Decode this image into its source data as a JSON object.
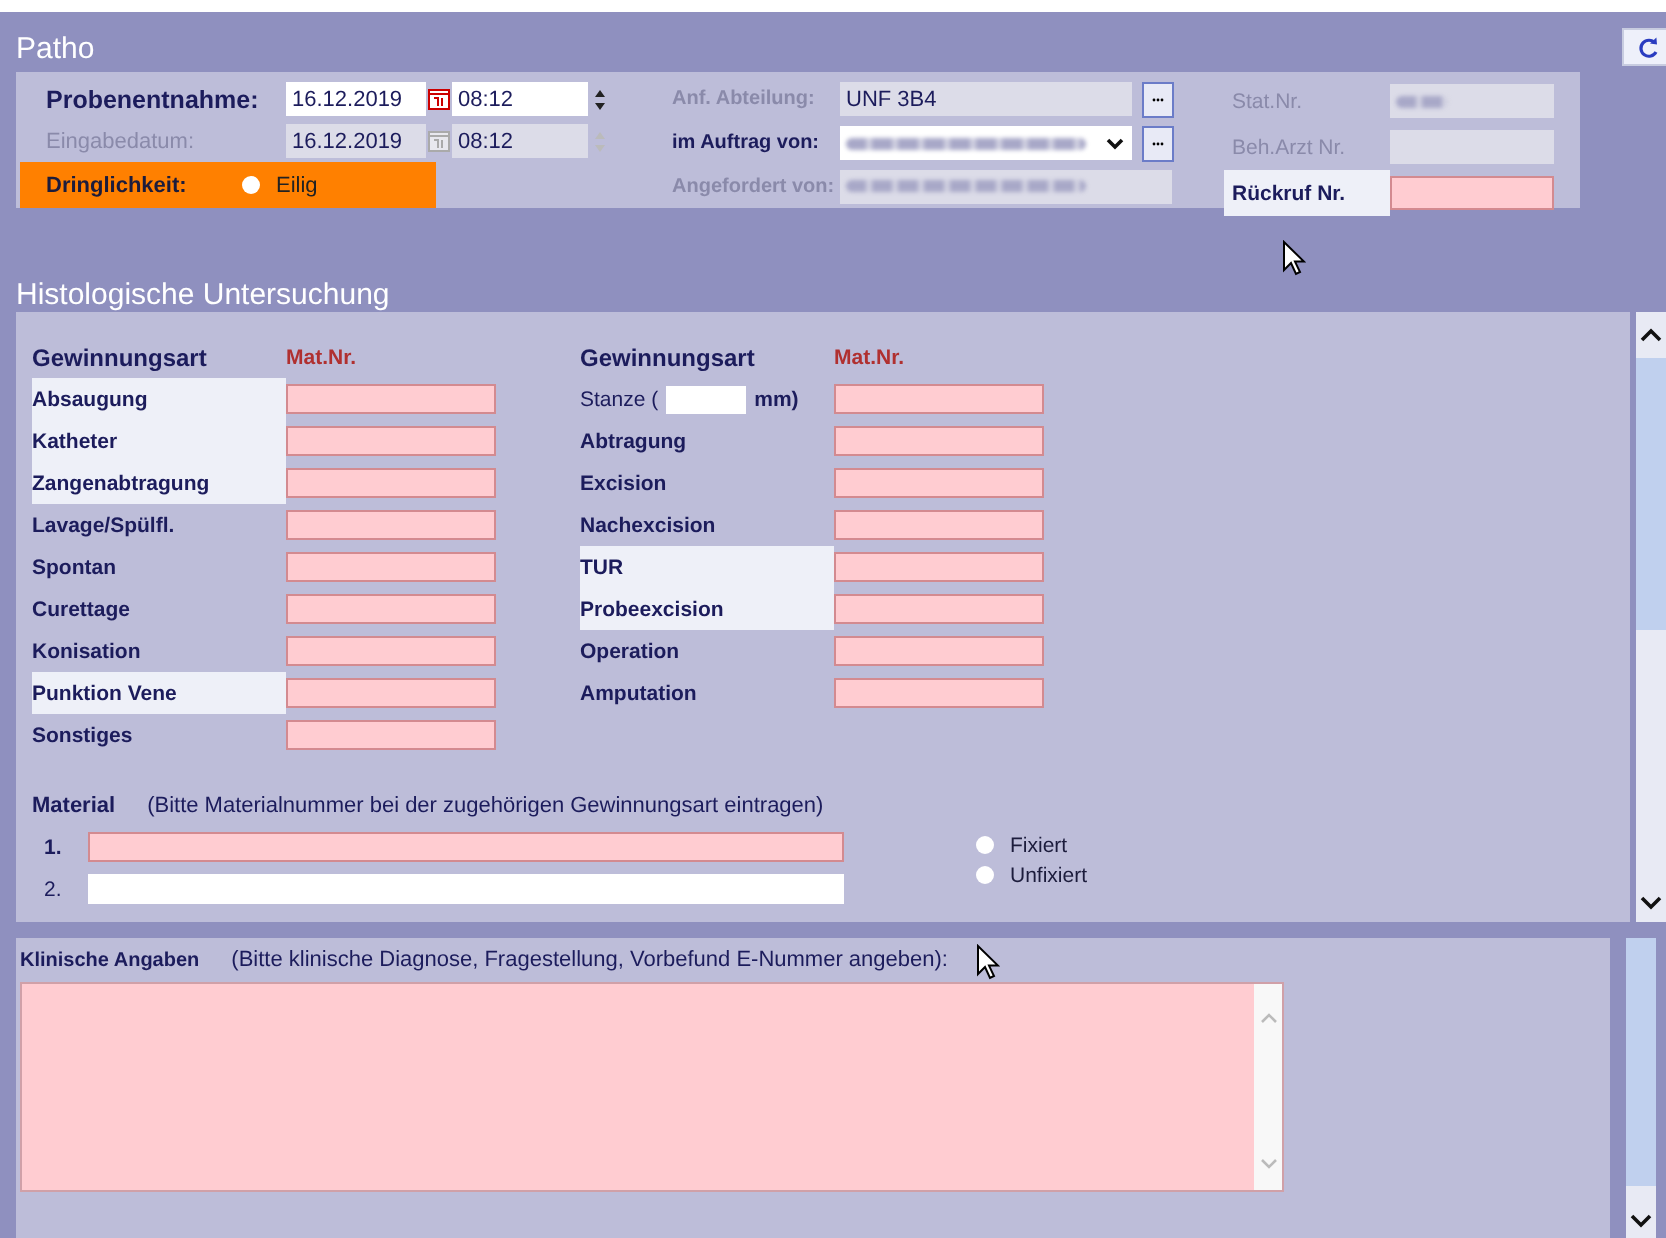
{
  "window": {
    "title": "Patho"
  },
  "header": {
    "date_rows": [
      {
        "label": "Probenentnahme:",
        "date": "16.12.2019",
        "time": "08:12",
        "disabled": false
      },
      {
        "label": "Eingabedatum:",
        "date": "16.12.2019",
        "time": "08:12",
        "disabled": true
      }
    ],
    "urgency": {
      "label": "Dringlichkeit:",
      "option": "Eilig",
      "selected": false
    },
    "middle_rows": [
      {
        "kind": "lookup",
        "label": "Anf. Abteilung:",
        "value": "UNF 3B4",
        "label_disabled": true,
        "redacted": false
      },
      {
        "kind": "dropdown",
        "label": "im Auftrag von:",
        "label_disabled": false,
        "redacted": true
      },
      {
        "kind": "readonly",
        "label": "Angefordert von:",
        "label_disabled": true,
        "redacted": true
      }
    ],
    "right_rows": [
      {
        "label": "Stat.Nr.",
        "disabled": true,
        "highlighted": false,
        "redacted": true
      },
      {
        "label": "Beh.Arzt Nr.",
        "disabled": true,
        "highlighted": false,
        "redacted": false
      },
      {
        "label": "Rückruf Nr.",
        "disabled": false,
        "highlighted": true,
        "redacted": false
      }
    ]
  },
  "histology": {
    "title": "Histologische Untersuchung",
    "columns": [
      {
        "heading": "Gewinnungsart",
        "mat_heading": "Mat.Nr.",
        "items": [
          {
            "kind": "plain",
            "label": "Absaugung",
            "highlighted": true
          },
          {
            "kind": "plain",
            "label": "Katheter",
            "highlighted": true
          },
          {
            "kind": "plain",
            "label": "Zangenabtragung",
            "highlighted": true
          },
          {
            "kind": "plain",
            "label": "Lavage/Spülfl.",
            "highlighted": false
          },
          {
            "kind": "plain",
            "label": "Spontan",
            "highlighted": false
          },
          {
            "kind": "plain",
            "label": "Curettage",
            "highlighted": false
          },
          {
            "kind": "plain",
            "label": "Konisation",
            "highlighted": false
          },
          {
            "kind": "plain",
            "label": "Punktion Vene",
            "highlighted": true
          },
          {
            "kind": "plain",
            "label": "Sonstiges",
            "highlighted": false
          }
        ]
      },
      {
        "heading": "Gewinnungsart",
        "mat_heading": "Mat.Nr.",
        "items": [
          {
            "kind": "size",
            "label": "Stanze (",
            "suffix": "mm)",
            "highlighted": false
          },
          {
            "kind": "plain",
            "label": "Abtragung",
            "highlighted": false
          },
          {
            "kind": "plain",
            "label": "Excision",
            "highlighted": false
          },
          {
            "kind": "plain",
            "label": "Nachexcision",
            "highlighted": false
          },
          {
            "kind": "plain",
            "label": "TUR",
            "highlighted": true
          },
          {
            "kind": "plain",
            "label": "Probeexcision",
            "highlighted": true
          },
          {
            "kind": "plain",
            "label": "Operation",
            "highlighted": false
          },
          {
            "kind": "plain",
            "label": "Amputation",
            "highlighted": false
          }
        ]
      }
    ],
    "material": {
      "label": "Material",
      "hint": "(Bitte Materialnummer bei der zugehörigen Gewinnungsart eintragen)",
      "lines": [
        {
          "number": "1.",
          "required": true
        },
        {
          "number": "2.",
          "required": false
        }
      ],
      "fixation": [
        {
          "label": "Fixiert",
          "selected": false
        },
        {
          "label": "Unfixiert",
          "selected": false
        }
      ]
    }
  },
  "clinical": {
    "label": "Klinische Angaben",
    "hint": "(Bitte klinische Diagnose, Fragestellung, Vorbefund E-Nummer angeben):"
  }
}
